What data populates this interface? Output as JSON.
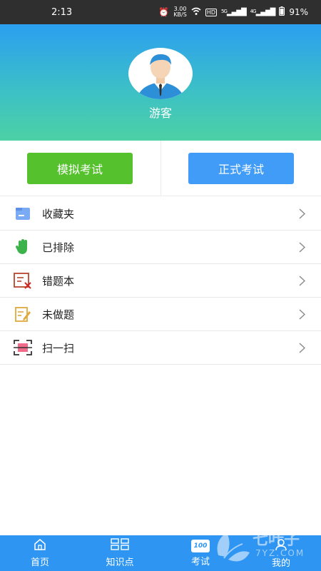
{
  "status_bar": {
    "time": "2:13",
    "net_speed_value": "3.00",
    "net_speed_unit": "KB/S",
    "hd_label": "HD",
    "sim1": "5G",
    "sim2": "4G",
    "battery": "91%"
  },
  "profile": {
    "name": "游客"
  },
  "exam_buttons": {
    "mock": "模拟考试",
    "formal": "正式考试"
  },
  "menu": {
    "items": [
      {
        "label": "收藏夹",
        "icon": "folder-icon"
      },
      {
        "label": "已排除",
        "icon": "hand-icon"
      },
      {
        "label": "错题本",
        "icon": "wrong-book-icon"
      },
      {
        "label": "未做题",
        "icon": "note-edit-icon"
      },
      {
        "label": "扫一扫",
        "icon": "scan-icon"
      }
    ]
  },
  "tabbar": {
    "tabs": [
      {
        "label": "首页",
        "icon": "home-icon"
      },
      {
        "label": "知识点",
        "icon": "grid-icon"
      },
      {
        "label": "考试",
        "icon": "exam-icon"
      },
      {
        "label": "我的",
        "icon": "user-icon"
      }
    ],
    "active_tab": "考试",
    "exam_icon_text": "100"
  },
  "watermark": {
    "text": "七叶子",
    "domain": "7YZ.COM"
  },
  "colors": {
    "status_bar": "#2f2f2f",
    "header_top": "#2b9ff0",
    "header_bottom": "#4cd1a4",
    "mock_button": "#55c12d",
    "formal_button": "#409cf7",
    "tabbar": "#2f95f2"
  }
}
